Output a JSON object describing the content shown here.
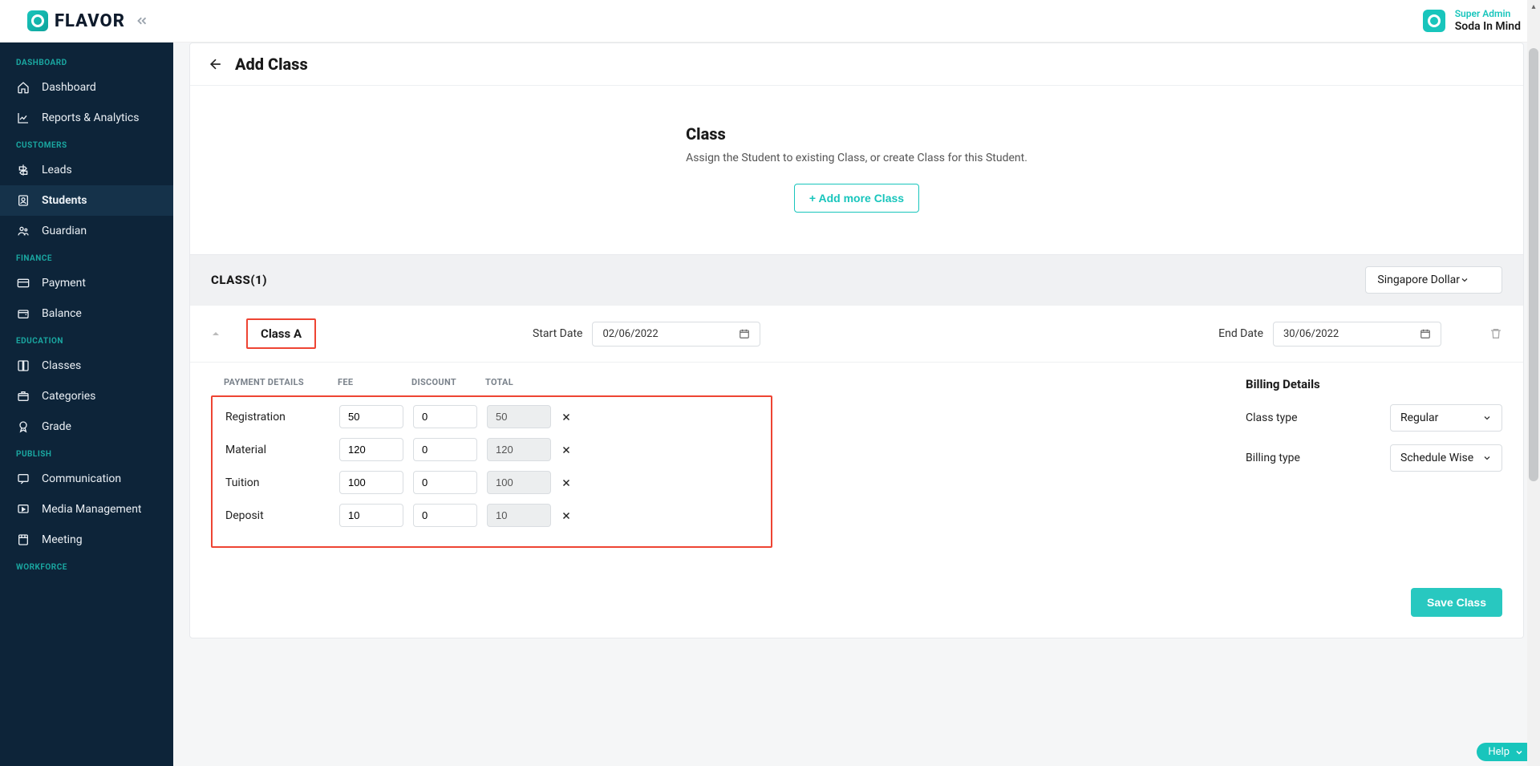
{
  "brand": {
    "name": "FLAVOR"
  },
  "user": {
    "role": "Super Admin",
    "name": "Soda In Mind"
  },
  "sidebar": {
    "sections": [
      {
        "label": "DASHBOARD",
        "items": [
          {
            "label": "Dashboard",
            "icon": "home-icon"
          },
          {
            "label": "Reports & Analytics",
            "icon": "chart-icon"
          }
        ]
      },
      {
        "label": "CUSTOMERS",
        "items": [
          {
            "label": "Leads",
            "icon": "signpost-icon"
          },
          {
            "label": "Students",
            "icon": "person-card-icon",
            "active": true
          },
          {
            "label": "Guardian",
            "icon": "guardian-icon"
          }
        ]
      },
      {
        "label": "FINANCE",
        "items": [
          {
            "label": "Payment",
            "icon": "card-icon"
          },
          {
            "label": "Balance",
            "icon": "wallet-icon"
          }
        ]
      },
      {
        "label": "EDUCATION",
        "items": [
          {
            "label": "Classes",
            "icon": "book-icon"
          },
          {
            "label": "Categories",
            "icon": "box-icon"
          },
          {
            "label": "Grade",
            "icon": "grade-icon"
          }
        ]
      },
      {
        "label": "PUBLISH",
        "items": [
          {
            "label": "Communication",
            "icon": "chat-icon"
          },
          {
            "label": "Media Management",
            "icon": "media-icon"
          },
          {
            "label": "Meeting",
            "icon": "meeting-icon"
          }
        ]
      },
      {
        "label": "WORKFORCE",
        "items": []
      }
    ]
  },
  "page": {
    "title": "Add Class",
    "intro": {
      "heading": "Class",
      "sub": "Assign the Student to existing Class, or create Class for this Student.",
      "add_btn": "+ Add more Class"
    },
    "class_strip": {
      "title": "CLASS(1)",
      "currency": "Singapore Dollar"
    },
    "class_row": {
      "name": "Class A",
      "start_label": "Start Date",
      "start_value": "02/06/2022",
      "end_label": "End Date",
      "end_value": "30/06/2022"
    },
    "payment": {
      "headers": {
        "details": "PAYMENT DETAILS",
        "fee": "FEE",
        "discount": "DISCOUNT",
        "total": "TOTAL"
      },
      "rows": [
        {
          "label": "Registration",
          "fee": "50",
          "discount": "0",
          "total": "50"
        },
        {
          "label": "Material",
          "fee": "120",
          "discount": "0",
          "total": "120"
        },
        {
          "label": "Tuition",
          "fee": "100",
          "discount": "0",
          "total": "100"
        },
        {
          "label": "Deposit",
          "fee": "10",
          "discount": "0",
          "total": "10"
        }
      ]
    },
    "billing": {
      "heading": "Billing Details",
      "class_type_label": "Class type",
      "class_type_value": "Regular",
      "billing_type_label": "Billing type",
      "billing_type_value": "Schedule Wise"
    },
    "save_label": "Save Class"
  },
  "help": {
    "label": "Help"
  }
}
